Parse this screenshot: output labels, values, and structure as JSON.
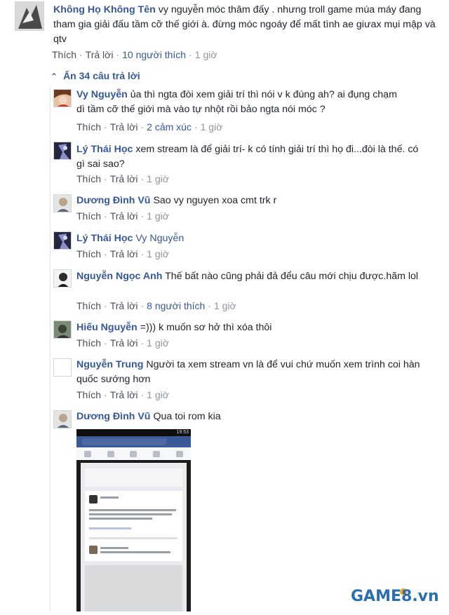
{
  "main_comment": {
    "author": "Không Họ Không Tên",
    "text": "vy nguyễn móc thâm đấy . nhưng troll game múa máy đang tham gia giải đấu tầm cỡ thế giới à. đừng móc ngoáy để mất tình ae giưax mụi mập và qtv",
    "like_label": "Thích",
    "reply_label": "Trả lời",
    "likes_count": "10 người thích",
    "time": "1 giờ"
  },
  "hide_replies_label": "Ẩn 34 câu trả lời",
  "replies": [
    {
      "author": "Vy Nguyễn",
      "text": "ủa thì ngta đòi xem giải trí thì nói v k đúng ah? ai đụng chạm dì tầm cỡ thế giới mà vào tự nhột rồi bảo ngta nói móc ?",
      "like_label": "Thích",
      "reply_label": "Trả lời",
      "reactions": "2 cảm xúc",
      "time": "1 giờ"
    },
    {
      "author": "Lý Thái Học",
      "text": "xem stream là để giải trí- k có tính giải trí thì họ đi...đòi là thế. có gì sai sao?",
      "like_label": "Thích",
      "reply_label": "Trả lời",
      "time": "1 giờ"
    },
    {
      "author": "Dương Đình Vũ",
      "text": "Sao vy nguyen xoa cmt trk r",
      "like_label": "Thích",
      "reply_label": "Trả lời",
      "time": "1 giờ"
    },
    {
      "author": "Lý Thái Học",
      "text": "Vy Nguyễn",
      "like_label": "Thích",
      "reply_label": "Trả lời",
      "time": "1 giờ"
    },
    {
      "author": "Nguyễn Ngọc Anh",
      "text": "Thế bất nào cũng phải đả đểu câu mới chịu được.hãm lol",
      "like_label": "Thích",
      "reply_label": "Trả lời",
      "likes_count": "8 người thích",
      "time": "1 giờ"
    },
    {
      "author": "Hiếu Nguyễn",
      "text": "=))) k muốn sơ hở thì xóa thôi",
      "like_label": "Thích",
      "reply_label": "Trả lời",
      "time": "1 giờ"
    },
    {
      "author": "Nguyễn Trung",
      "text": "Người ta xem stream vn là để vui chứ muốn xem trình coi hàn quốc sướng hơn",
      "like_label": "Thích",
      "reply_label": "Trả lời",
      "time": "1 giờ"
    },
    {
      "author": "Dương Đình Vũ",
      "text": "Qua toi rom kia"
    }
  ],
  "phone_status_time": "19:53",
  "watermark": "GAME8.vn",
  "colors": {
    "link_blue": "#365899",
    "text": "#1d2129",
    "meta_gray": "#90949c",
    "watermark_blue": "#2a6fb0",
    "watermark_orange": "#f5a623"
  }
}
